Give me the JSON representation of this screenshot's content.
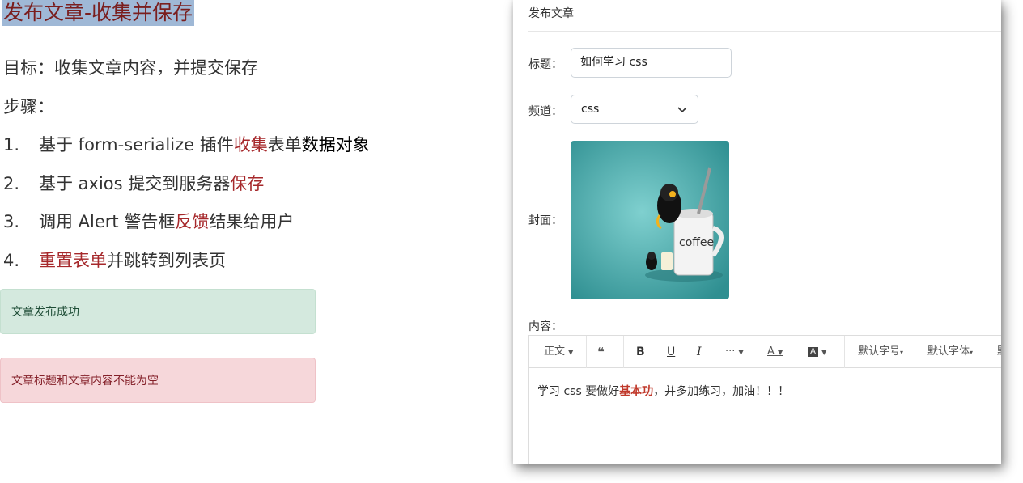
{
  "slide": {
    "title": "发布文章-收集并保存",
    "goal": "目标：收集文章内容，并提交保存",
    "steps_label": "步骤：",
    "steps": [
      {
        "num": "1.",
        "p1": "基于 form-serialize 插件",
        "p2": "收集",
        "p3": "表单",
        "p4": "数据对象",
        "p5": ""
      },
      {
        "num": "2.",
        "p1": "基于 axios 提交到服务器",
        "p2": "保存",
        "p3": "",
        "p4": "",
        "p5": ""
      },
      {
        "num": "3.",
        "p1": "调用 Alert 警告框",
        "p2": "反馈",
        "p3": "结果给用户",
        "p4": "",
        "p5": ""
      },
      {
        "num": "4.",
        "p1": "",
        "p2": "重置表单",
        "p3": "并跳转到列表页",
        "p4": "",
        "p5": ""
      }
    ],
    "alert_success": "文章发布成功",
    "alert_danger": "文章标题和文章内容不能为空"
  },
  "form": {
    "panel_title": "发布文章",
    "title_label": "标题：",
    "title_value": "如何学习 css",
    "channel_label": "频道：",
    "channel_value": "css",
    "cover_label": "封面：",
    "cover_text": "coffee",
    "content_label": "内容：",
    "toolbar": {
      "paragraph": "正文",
      "fontsize": "默认字号",
      "fontfamily": "默认字体",
      "cut": "默"
    },
    "content": {
      "before": "学习 css 要做好",
      "bold": "基本功",
      "after": "，并多加练习，加油！！！"
    }
  },
  "colors": {
    "accent_red": "#a6282b",
    "title_bg": "#9fb8d6",
    "success_bg": "#d4e9de",
    "danger_bg": "#f6d7da",
    "cover_bg": "#4fb3b3"
  }
}
